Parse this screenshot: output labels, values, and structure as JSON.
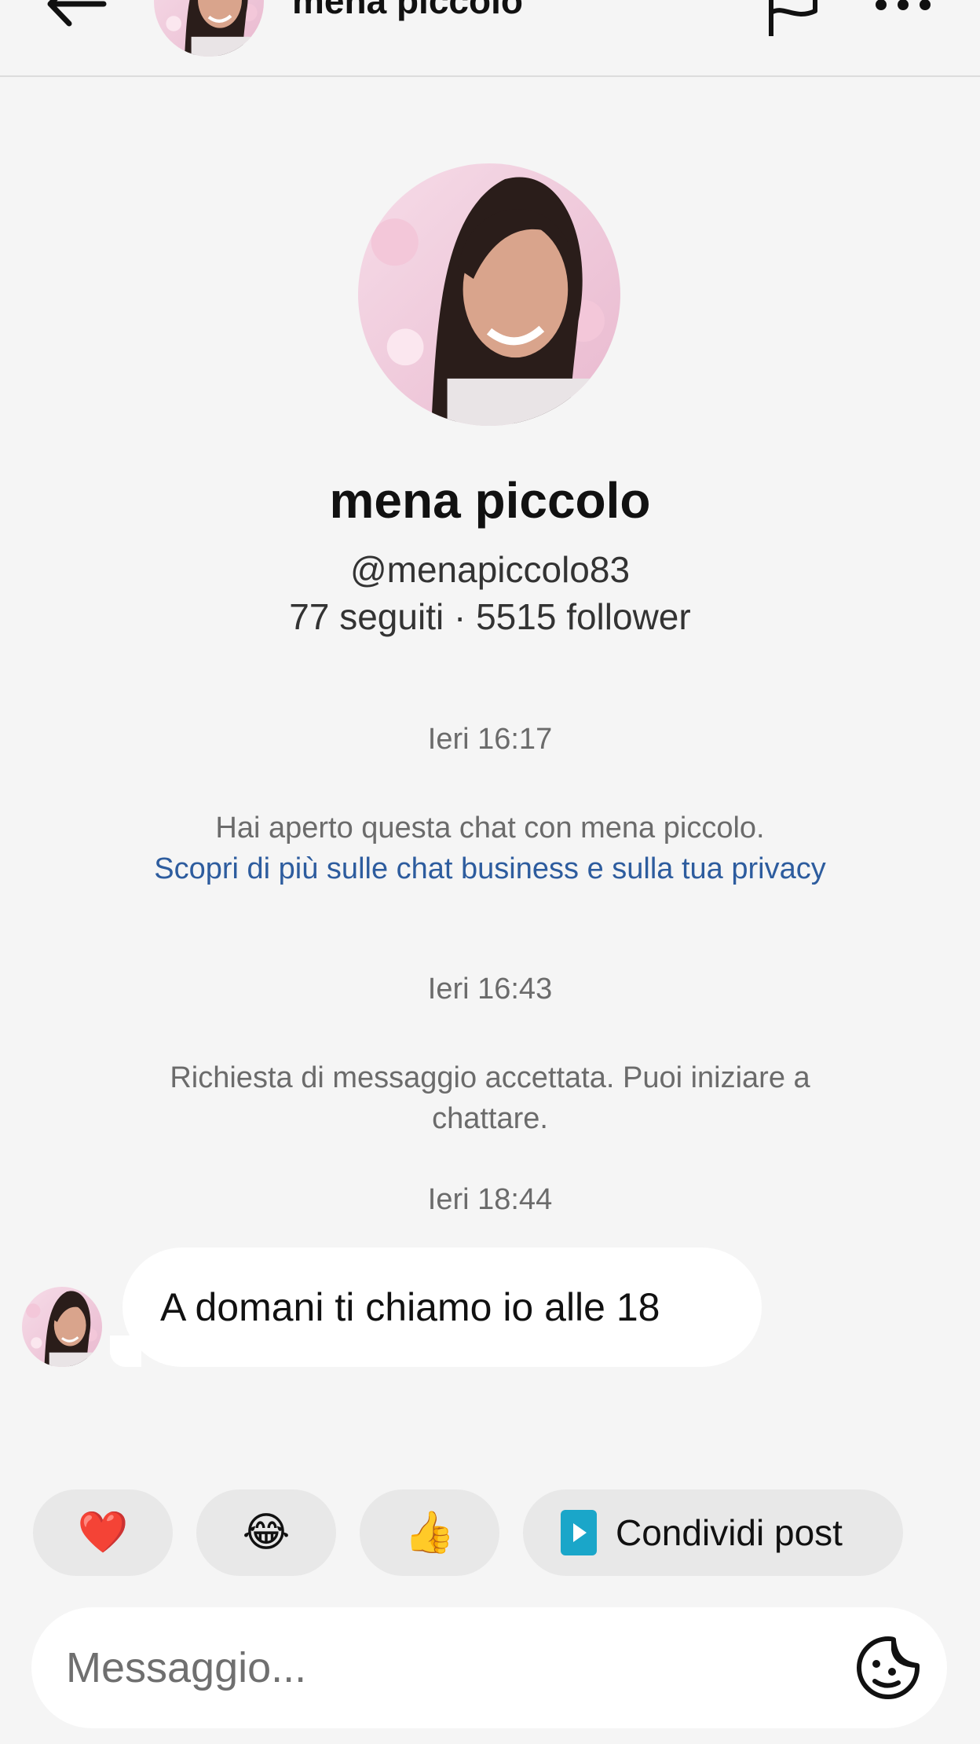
{
  "header": {
    "title": "mena piccolo"
  },
  "profile": {
    "name": "mena piccolo",
    "handle": "@menapiccolo83",
    "stats": "77 seguiti · 5515 follower"
  },
  "conversation": {
    "timestamp_1": "Ieri 16:17",
    "opened_notice": "Hai aperto questa chat con mena piccolo.",
    "privacy_link": "Scopri di più sulle chat business e sulla tua privacy",
    "timestamp_2": "Ieri 16:43",
    "accepted_notice": "Richiesta di messaggio accettata. Puoi iniziare a chattare.",
    "timestamp_3": "Ieri 18:44",
    "messages": [
      {
        "text": "A domani ti chiamo io alle 18"
      }
    ]
  },
  "quick_replies": {
    "heart": "❤️",
    "laugh": "😂",
    "thumbs_up": "👍",
    "share_post": "Condividi post",
    "share_icon_color": "#1aa6c9"
  },
  "composer": {
    "placeholder": "Messaggio...",
    "value": ""
  },
  "colors": {
    "background": "#f5f5f5",
    "link": "#2d5c9e",
    "muted": "#6b6b6b",
    "chip": "#e8e8e8"
  }
}
